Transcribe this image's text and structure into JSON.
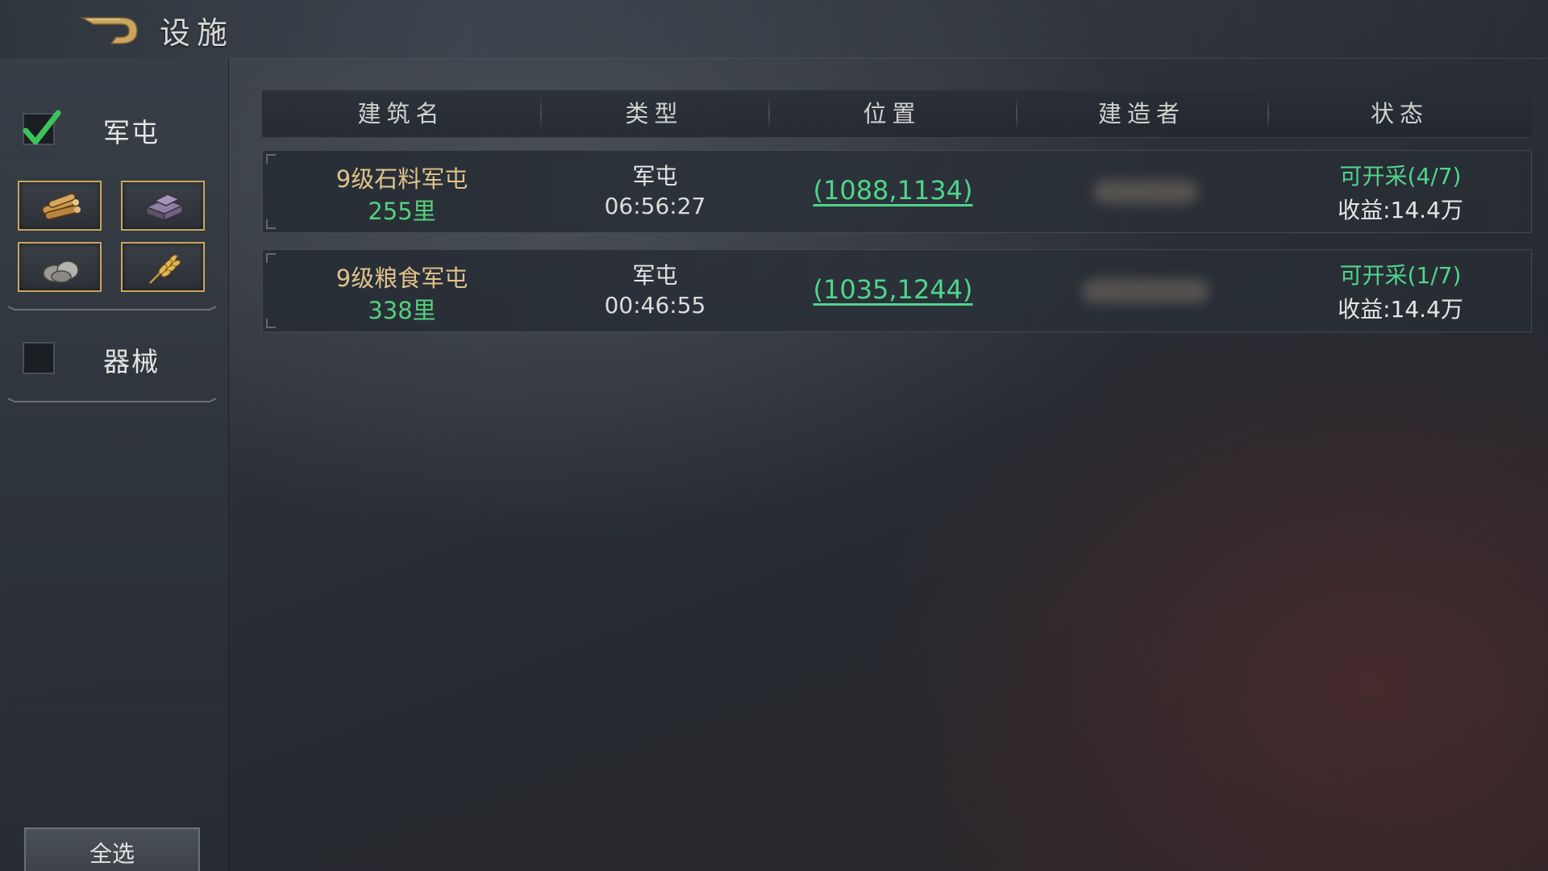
{
  "header": {
    "title": "设施"
  },
  "sidebar": {
    "categories": [
      {
        "label": "军屯",
        "checked": true
      },
      {
        "label": "器械",
        "checked": false
      }
    ],
    "resource_filters": [
      {
        "icon": "wood-icon"
      },
      {
        "icon": "iron-icon"
      },
      {
        "icon": "stone-icon"
      },
      {
        "icon": "grain-icon"
      }
    ],
    "select_all_label": "全选"
  },
  "table": {
    "columns": [
      "建筑名",
      "类型",
      "位置",
      "建造者",
      "状态"
    ],
    "rows": [
      {
        "name": "9级石料军屯",
        "distance": "255里",
        "type": "军屯",
        "time": "06:56:27",
        "position": "(1088,1134)",
        "status": "可开采(4/7)",
        "income": "收益:14.4万"
      },
      {
        "name": "9级粮食军屯",
        "distance": "338里",
        "type": "军屯",
        "time": "00:46:55",
        "position": "(1035,1244)",
        "status": "可开采(1/7)",
        "income": "收益:14.4万"
      }
    ]
  },
  "colors": {
    "accent_gold": "#c9a560",
    "name_gold": "#e1c38b",
    "positive_green": "#4fd58b",
    "check_green": "#3cc35a"
  }
}
